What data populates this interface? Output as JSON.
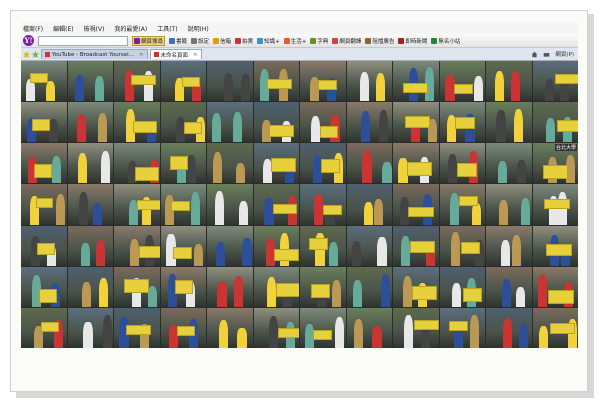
{
  "menu": [
    "檔案(F)",
    "編輯(E)",
    "檢視(V)",
    "我的最愛(A)",
    "工具(T)",
    "說明(H)"
  ],
  "toolbar": {
    "logo": "Y!",
    "search_value": "",
    "buttons": [
      {
        "label": "網頁搜尋",
        "active": true,
        "color": "#7b1fa2"
      },
      {
        "label": "書籤",
        "active": false,
        "color": "#3d6fbf"
      },
      {
        "label": "設定",
        "active": false,
        "color": "#777777"
      },
      {
        "label": "信箱",
        "active": false,
        "color": "#e0a000"
      },
      {
        "label": "拍賣",
        "active": false,
        "color": "#cc3333"
      },
      {
        "label": "知識+",
        "active": false,
        "color": "#3399cc"
      },
      {
        "label": "生活+",
        "active": false,
        "color": "#e06020"
      },
      {
        "label": "字典",
        "active": false,
        "color": "#6a8f2a"
      },
      {
        "label": "網頁翻譯",
        "active": false,
        "color": "#c44"
      },
      {
        "label": "阻擋廣告",
        "active": false,
        "color": "#886633"
      },
      {
        "label": "即時新聞",
        "active": false,
        "color": "#aa2222"
      },
      {
        "label": "無名小站",
        "active": false,
        "color": "#228833"
      }
    ]
  },
  "tabs": [
    {
      "title": "YouTube - Broadcast Yoursel...",
      "active": false
    },
    {
      "title": "未命名頁面",
      "active": true
    }
  ],
  "tab_right": {
    "page_label": "網頁(P)"
  },
  "grid": {
    "colors": [
      "#7c8a7a",
      "#5c6e7e",
      "#8a7a6a",
      "#6a7f5a",
      "#4f5f6f",
      "#8f8f7f",
      "#5e6a4e",
      "#7a6a5c"
    ],
    "caption": "台北大學"
  }
}
